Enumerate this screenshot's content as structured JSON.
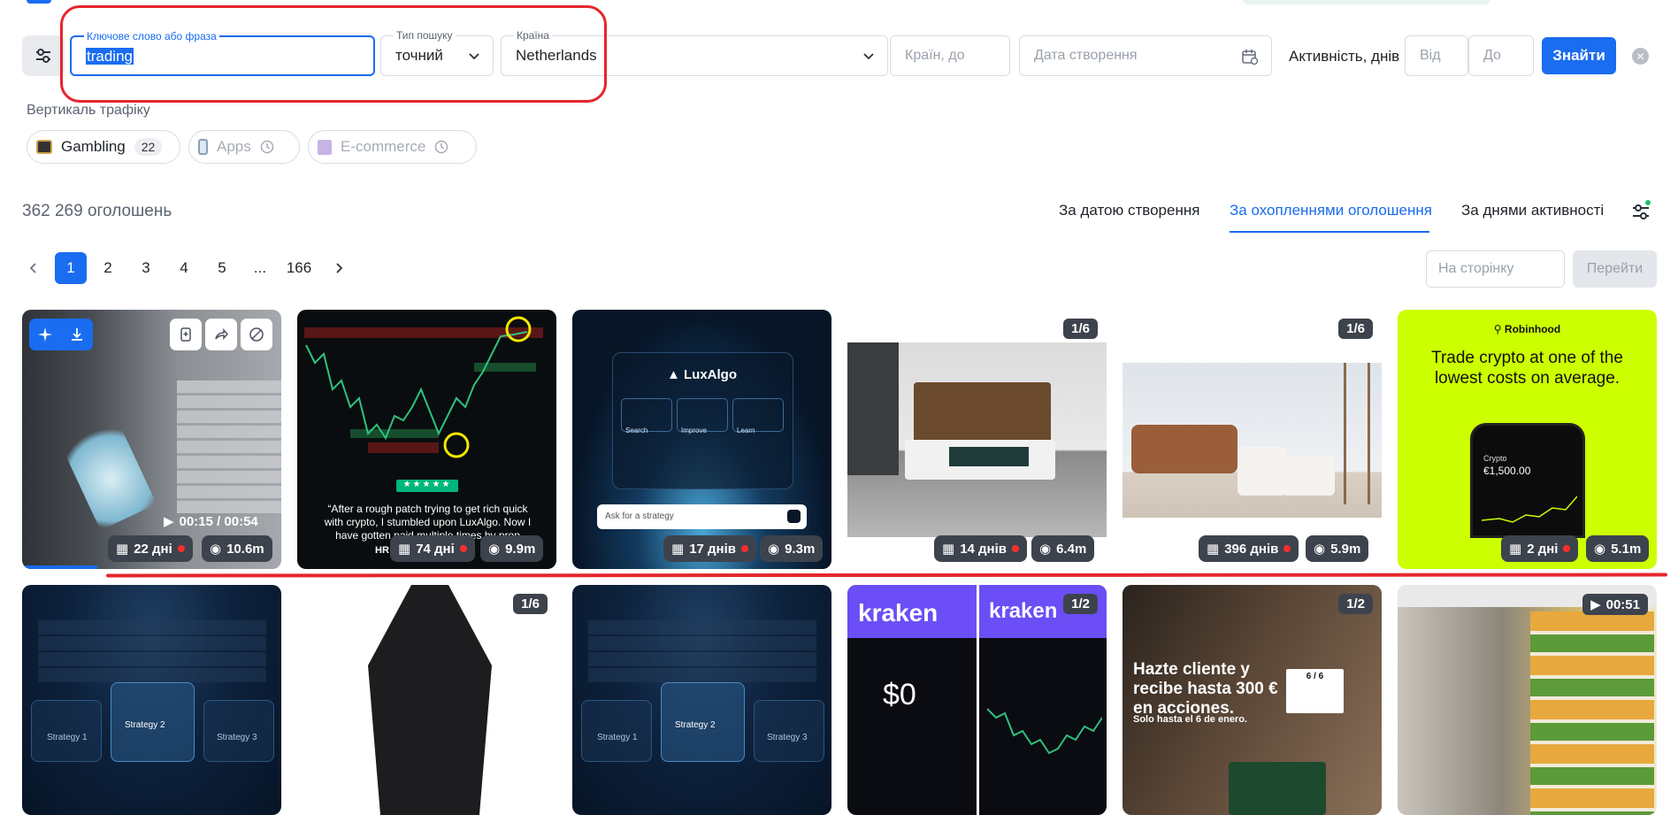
{
  "search": {
    "keyword_label": "Ключове слово або фраза",
    "keyword_value": "trading",
    "type_label": "Тип пошуку",
    "type_value": "точний",
    "country_label": "Країна",
    "country_value": "Netherlands",
    "countries_placeholder": "Країн, до",
    "date_placeholder": "Дата створення",
    "activity_label": "Активність, днів",
    "from_placeholder": "Від",
    "to_placeholder": "До",
    "find_label": "Знайти"
  },
  "vertical": {
    "title": "Вертикаль трафіку",
    "chips": [
      {
        "label": "Gambling",
        "count": "22"
      },
      {
        "label": "Apps"
      },
      {
        "label": "E-commerce"
      }
    ]
  },
  "results": {
    "total": "362 269 оголошень",
    "sort_options": [
      "За датою створення",
      "За охопленнями оголошення",
      "За днями активності"
    ]
  },
  "pagination": {
    "pages": [
      "1",
      "2",
      "3",
      "4",
      "5",
      "...",
      "166"
    ],
    "per_page_placeholder": "На сторінку",
    "go_label": "Перейти"
  },
  "cards_row1": [
    {
      "days": "22 дні",
      "reach": "10.6m",
      "video_time": "00:15 / 00:54"
    },
    {
      "days": "74 дні",
      "reach": "9.9m",
      "quote": "“After a rough patch trying to get rich quick with crypto, I stumbled upon LuxAlgo. Now I have gotten paid multiple times by prop trading firms.”",
      "author": "HR L"
    },
    {
      "days": "17 днів",
      "reach": "9.3m",
      "brand": "LuxAlgo",
      "features": [
        "Search",
        "Improve",
        "Learn"
      ],
      "ask": "Ask for a strategy"
    },
    {
      "days": "14 днів",
      "reach": "6.4m",
      "badge": "1/6"
    },
    {
      "days": "396 днів",
      "reach": "5.9m",
      "badge": "1/6"
    },
    {
      "days": "2 дні",
      "reach": "5.1m",
      "brand": "Robinhood",
      "headline": "Trade crypto at one of the lowest costs on average.",
      "phone_label": "Crypto",
      "phone_value": "€1,500.00"
    }
  ],
  "cards_row2": [
    {
      "strategies": [
        "Strategy 1",
        "Strategy 2",
        "Strategy 3"
      ]
    },
    {
      "badge": "1/6"
    },
    {
      "strategies": [
        "Strategy 1",
        "Strategy 2",
        "Strategy 3"
      ]
    },
    {
      "badge": "1/2",
      "brand": "kraken",
      "amount": "$0"
    },
    {
      "badge": "1/2",
      "headline": "Hazte cliente y recibe hasta 300 € en acciones.",
      "sub": "Solo hasta el 6 de enero.",
      "page": "6 / 6"
    },
    {
      "badge": "00:51"
    }
  ],
  "colors": {
    "accent": "#1a6cf0",
    "annotation": "#e5262d",
    "robinhood": "#ccff00"
  }
}
